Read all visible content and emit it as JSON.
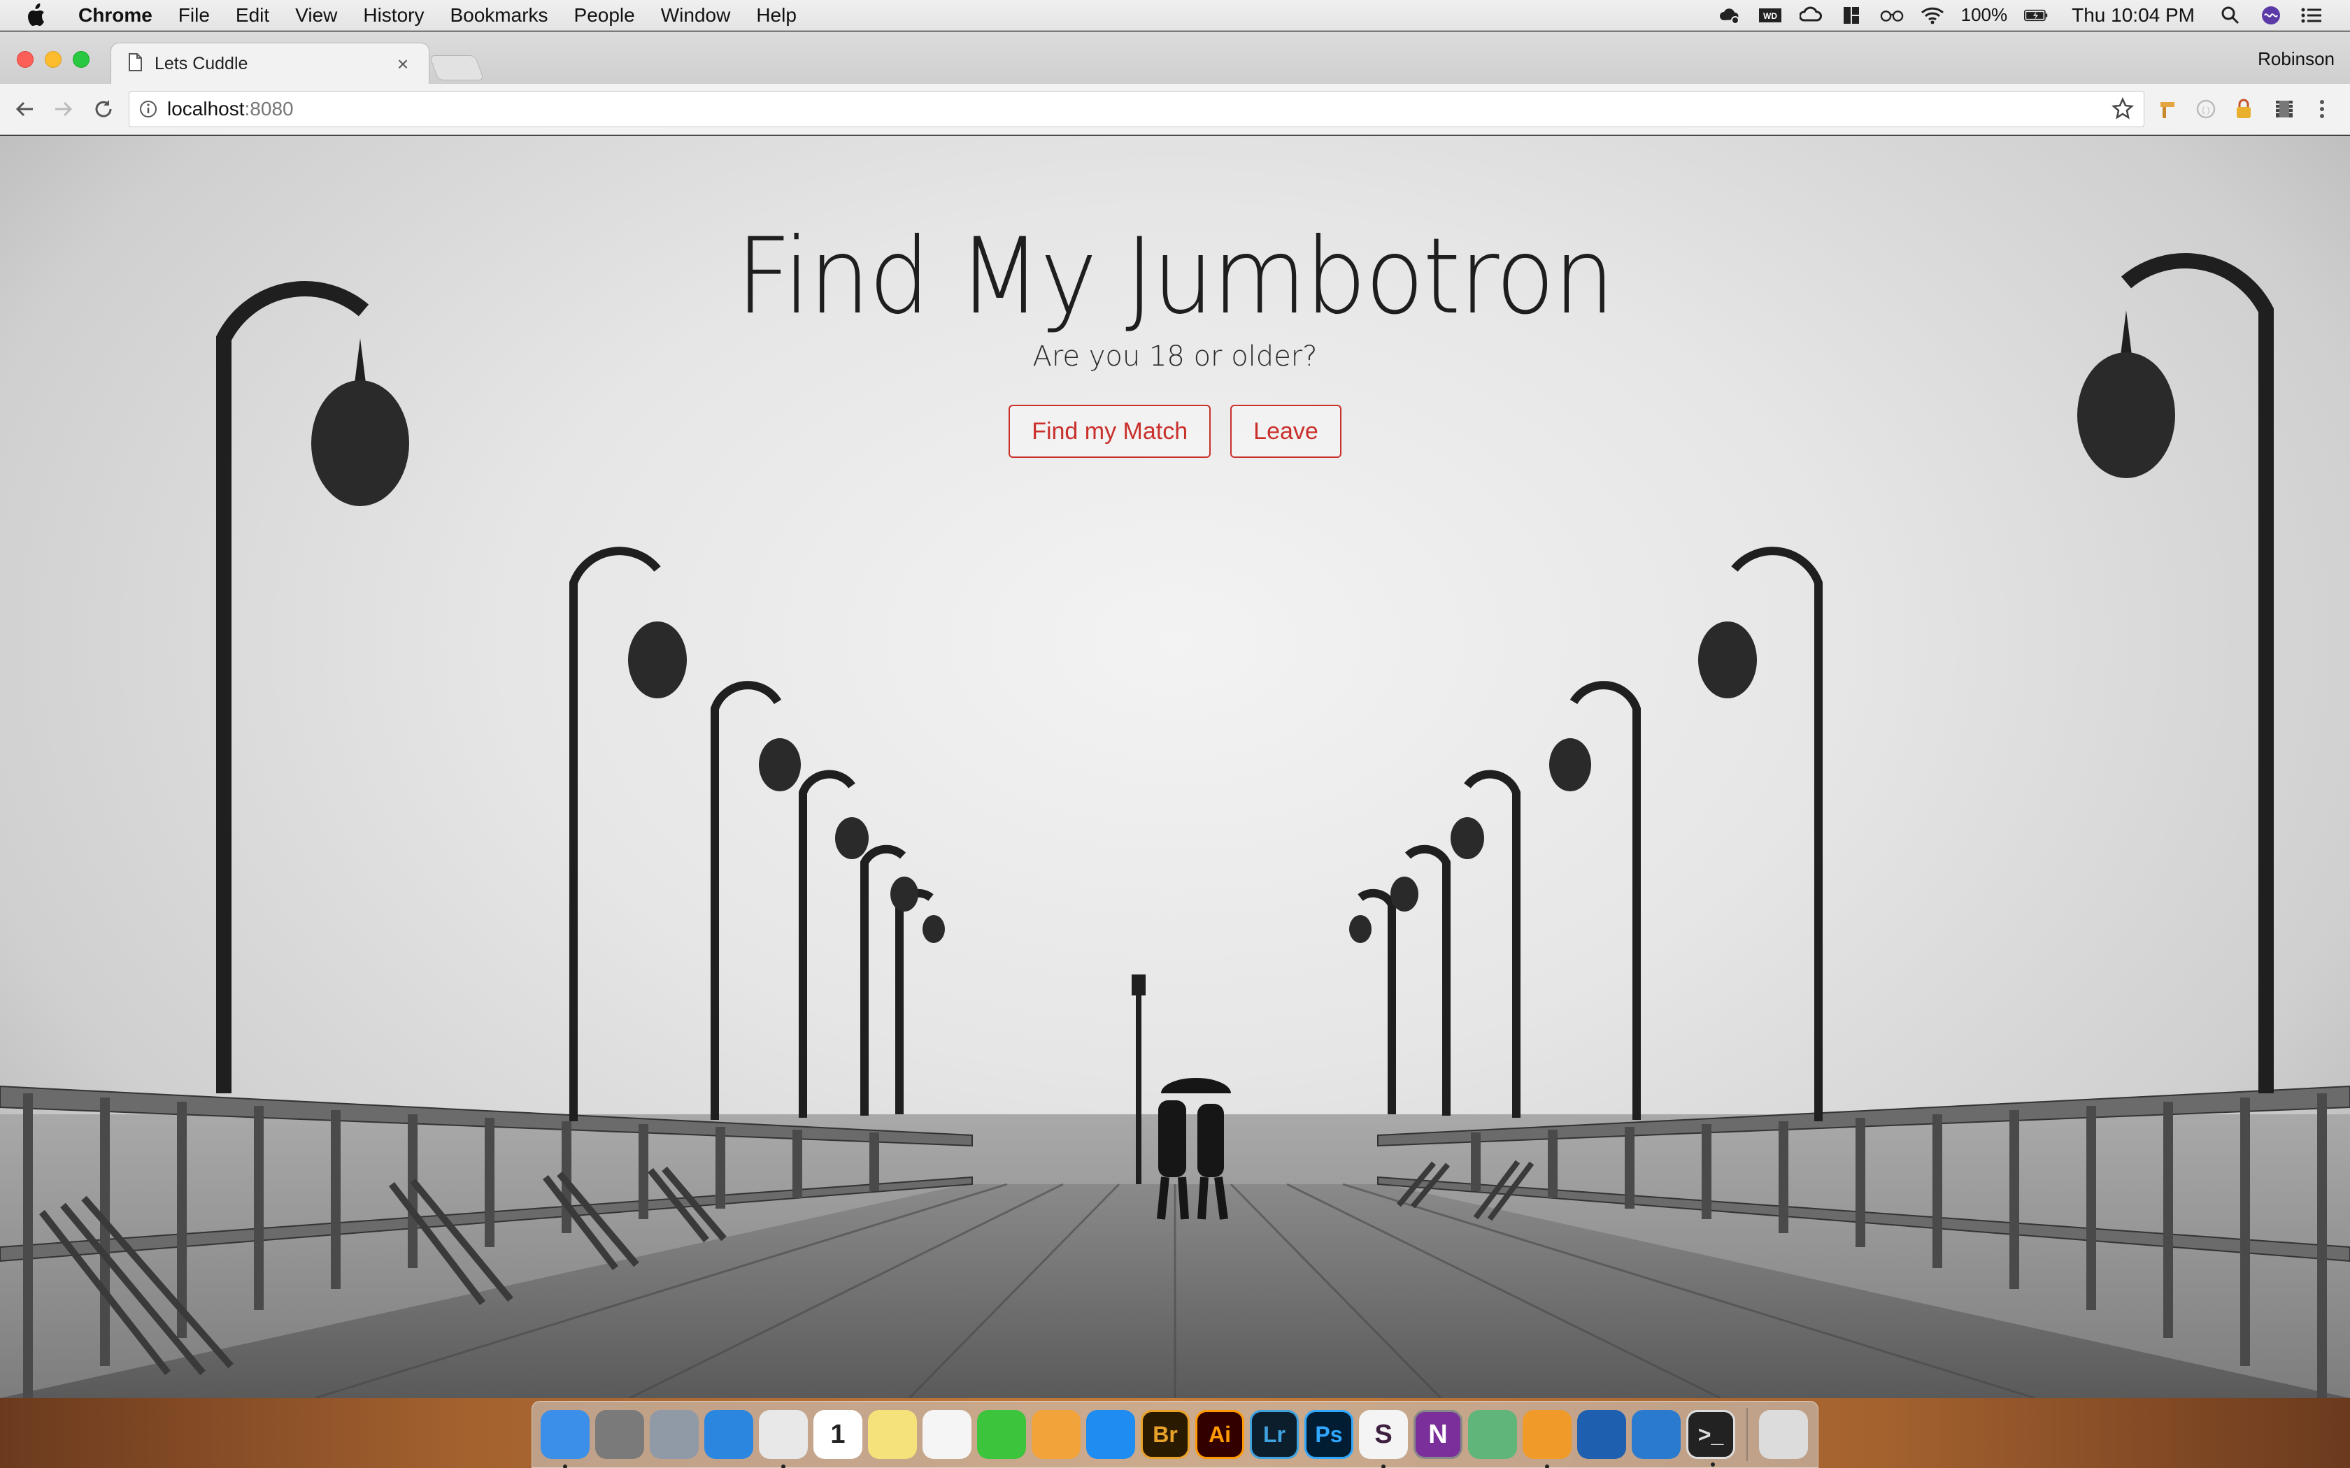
{
  "menubar": {
    "app_name": "Chrome",
    "items": [
      "File",
      "Edit",
      "View",
      "History",
      "Bookmarks",
      "People",
      "Window",
      "Help"
    ],
    "battery_percent": "100%",
    "clock": "Thu 10:04 PM"
  },
  "browser": {
    "tab_title": "Lets Cuddle",
    "tab_close": "×",
    "profile_name": "Robinson",
    "url_host": "localhost",
    "url_port": ":8080"
  },
  "jumbotron": {
    "title": "Find My Jumbotron",
    "subtitle": "Are you 18 or older?",
    "primary_button": "Find my Match",
    "secondary_button": "Leave",
    "button_color": "#c9302c"
  },
  "dock": {
    "apps": [
      {
        "name": "finder-icon",
        "label": "",
        "color": "#3b8fe8"
      },
      {
        "name": "system-preferences-icon",
        "label": "",
        "color": "#7a7a7a"
      },
      {
        "name": "launchpad-icon",
        "label": "",
        "color": "#8f9aa6"
      },
      {
        "name": "safari-icon",
        "label": "",
        "color": "#2b86e0"
      },
      {
        "name": "chrome-icon",
        "label": "",
        "color": "#e8e8e8"
      },
      {
        "name": "calendar-icon",
        "label": "1",
        "color": "#ffffff"
      },
      {
        "name": "notes-icon",
        "label": "",
        "color": "#f6e27a"
      },
      {
        "name": "reminders-icon",
        "label": "",
        "color": "#f5f5f5"
      },
      {
        "name": "facetime-icon",
        "label": "",
        "color": "#3cc43c"
      },
      {
        "name": "photos-icon",
        "label": "",
        "color": "#f2a33a"
      },
      {
        "name": "app-store-icon",
        "label": "",
        "color": "#1e8cf0"
      },
      {
        "name": "bridge-icon",
        "label": "Br",
        "color": "#2a1a00"
      },
      {
        "name": "illustrator-icon",
        "label": "Ai",
        "color": "#330000"
      },
      {
        "name": "lightroom-icon",
        "label": "Lr",
        "color": "#0c1e2c"
      },
      {
        "name": "photoshop-icon",
        "label": "Ps",
        "color": "#001d34"
      },
      {
        "name": "slack-icon",
        "label": "S",
        "color": "#f4f4f4"
      },
      {
        "name": "onenote-icon",
        "label": "N",
        "color": "#7a2f9a"
      },
      {
        "name": "atom-icon",
        "label": "",
        "color": "#5fb57a"
      },
      {
        "name": "sublime-icon",
        "label": "",
        "color": "#f09a2a"
      },
      {
        "name": "sourcetree-icon",
        "label": "",
        "color": "#1f5fb0"
      },
      {
        "name": "vscode-icon",
        "label": "",
        "color": "#2a7ad0"
      },
      {
        "name": "terminal-icon",
        "label": ">_",
        "color": "#222222"
      },
      {
        "name": "trash-icon",
        "label": "",
        "color": "#dcdcdc"
      }
    ]
  }
}
